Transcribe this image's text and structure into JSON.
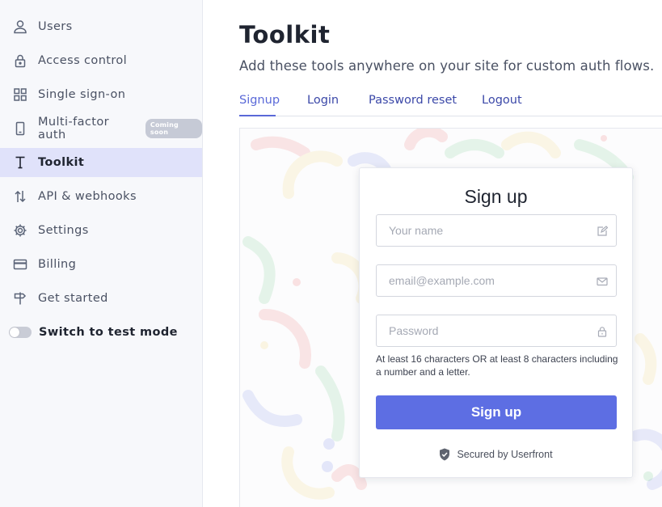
{
  "sidebar": {
    "items": [
      {
        "label": "Users",
        "icon": "user-icon"
      },
      {
        "label": "Access control",
        "icon": "lock-icon"
      },
      {
        "label": "Single sign-on",
        "icon": "grid-icon"
      },
      {
        "label": "Multi-factor auth",
        "icon": "phone-icon",
        "badge": "Coming soon"
      },
      {
        "label": "Toolkit",
        "icon": "toolkit-icon",
        "active": true
      },
      {
        "label": "API & webhooks",
        "icon": "arrows-icon"
      },
      {
        "label": "Settings",
        "icon": "gear-icon"
      },
      {
        "label": "Billing",
        "icon": "credit-card-icon"
      },
      {
        "label": "Get started",
        "icon": "signpost-icon"
      }
    ],
    "test_mode": {
      "label": "Switch to test mode",
      "enabled": false
    }
  },
  "main": {
    "title": "Toolkit",
    "subtitle": "Add these tools anywhere on your site for custom auth flows.",
    "tabs": [
      {
        "label": "Signup",
        "active": true
      },
      {
        "label": "Login"
      },
      {
        "label": "Password reset"
      },
      {
        "label": "Logout"
      }
    ]
  },
  "signup_form": {
    "title": "Sign up",
    "name_placeholder": "Your name",
    "email_placeholder": "email@example.com",
    "password_placeholder": "Password",
    "password_hint": "At least 16 characters OR at least 8 characters including a number and a letter.",
    "submit_label": "Sign up",
    "secured_by": "Secured by Userfront"
  },
  "colors": {
    "accent": "#5d6ee3",
    "tab_link": "#3b48a8",
    "active_nav_bg": "#e0e2fa",
    "sidebar_bg": "#f7f8fb"
  }
}
